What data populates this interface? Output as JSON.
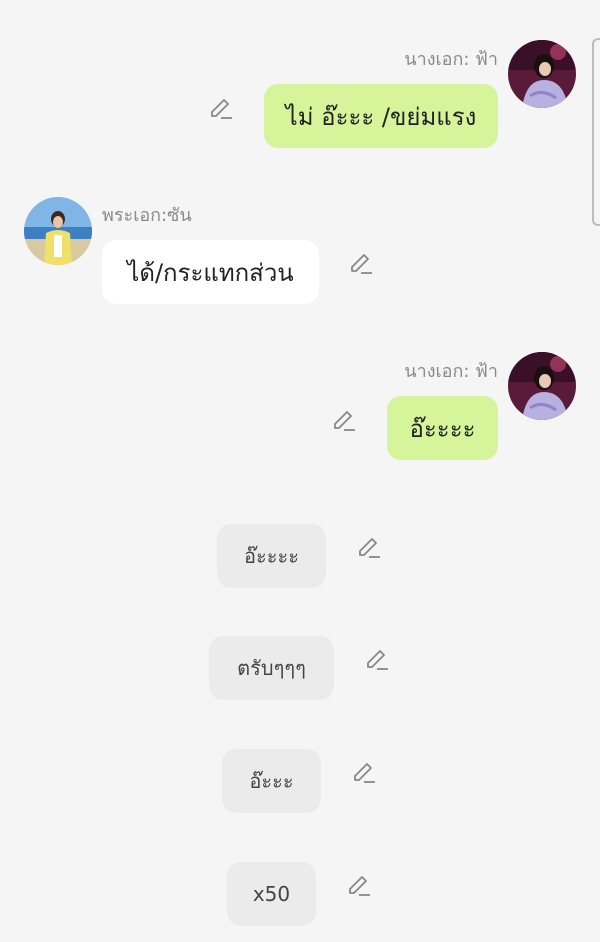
{
  "messages": [
    {
      "kind": "right",
      "sender": "นางเอก: ฟ้า",
      "text": "ไม่ อ๊ะะะ /ขย่มแรง",
      "avatar": "heroine-avatar"
    },
    {
      "kind": "left",
      "sender": "พระเอก:ซัน",
      "text": "ได้/กระแทกส่วน",
      "avatar": "hero-avatar"
    },
    {
      "kind": "right",
      "sender": "นางเอก: ฟ้า",
      "text": "อ๊ะะะะ",
      "avatar": "heroine-avatar"
    },
    {
      "kind": "center",
      "text": "อ๊ะะะะ"
    },
    {
      "kind": "center",
      "text": "ตรับๆๆๆ"
    },
    {
      "kind": "center",
      "text": "อ๊ะะะ"
    },
    {
      "kind": "center",
      "text": "x50"
    }
  ],
  "icons": {
    "edit": "pencil-icon"
  },
  "colors": {
    "background": "#f5f5f5",
    "green_bubble": "#d6f59a",
    "white_bubble": "#ffffff",
    "grey_bubble": "#ebebeb",
    "sender_text": "#8a8a8a"
  }
}
